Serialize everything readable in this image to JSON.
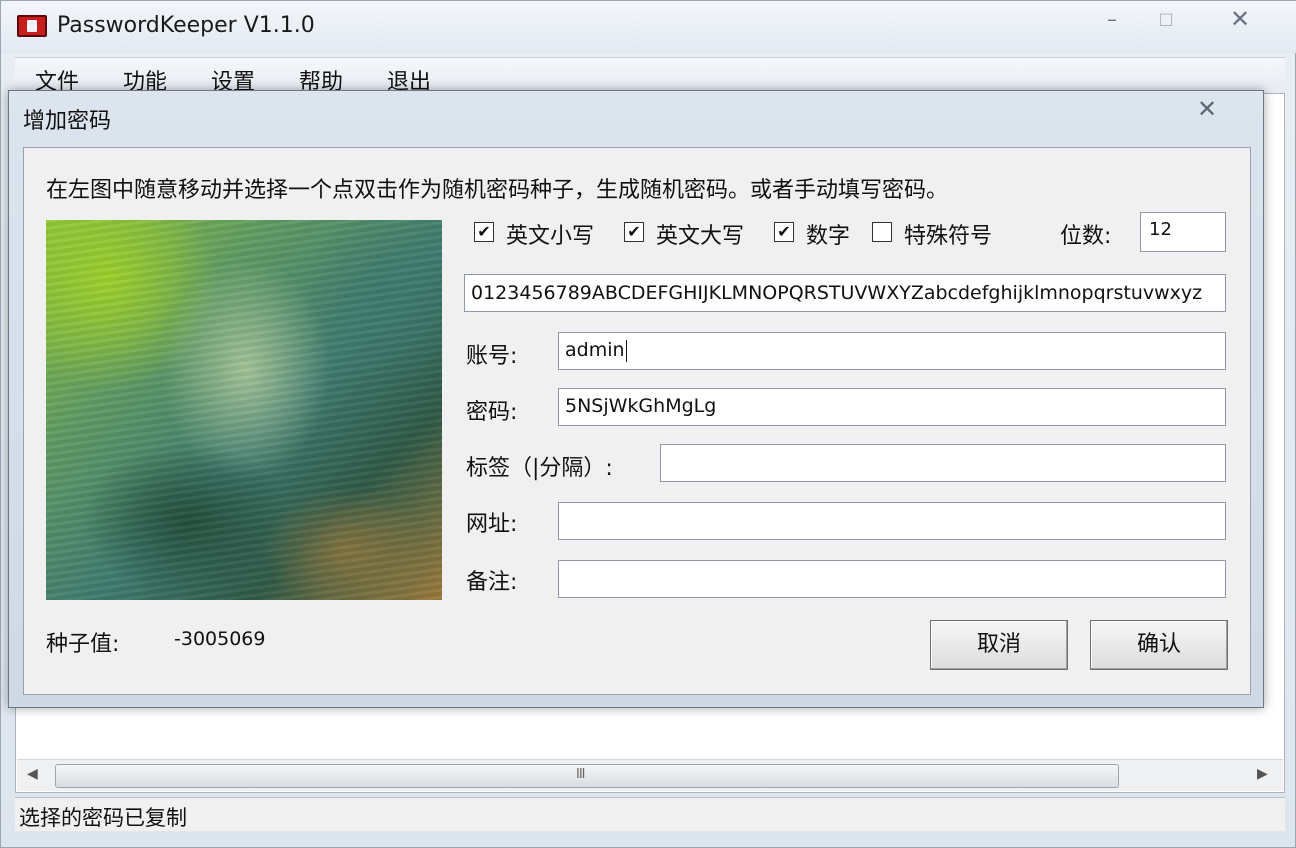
{
  "app": {
    "title": "PasswordKeeper V1.1.0",
    "menu": [
      "文件",
      "功能",
      "设置",
      "帮助",
      "退出"
    ],
    "status": "选择的密码已复制",
    "scroll_grip": "III"
  },
  "window_controls": {
    "minimize": "–",
    "maximize": "□",
    "close": "✕"
  },
  "dialog": {
    "title": "增加密码",
    "close": "✕",
    "instruction": "在左图中随意移动并选择一个点双击作为随机密码种子，生成随机密码。或者手动填写密码。",
    "options": [
      {
        "label": "英文小写",
        "checked": true
      },
      {
        "label": "英文大写",
        "checked": true
      },
      {
        "label": "数字",
        "checked": true
      },
      {
        "label": "特殊符号",
        "checked": false
      }
    ],
    "digits_label": "位数:",
    "digits_value": "12",
    "charset": "0123456789ABCDEFGHIJKLMNOPQRSTUVWXYZabcdefghijklmnopqrstuvwxyz",
    "fields": {
      "account_label": "账号:",
      "account_value": "admin",
      "password_label": "密码:",
      "password_value": "5NSjWkGhMgLg",
      "tags_label": "标签（|分隔）:",
      "tags_value": "",
      "url_label": "网址:",
      "url_value": "",
      "note_label": "备注:",
      "note_value": ""
    },
    "seed_label": "种子值:",
    "seed_value": "-3005069",
    "cancel_label": "取消",
    "confirm_label": "确认"
  }
}
